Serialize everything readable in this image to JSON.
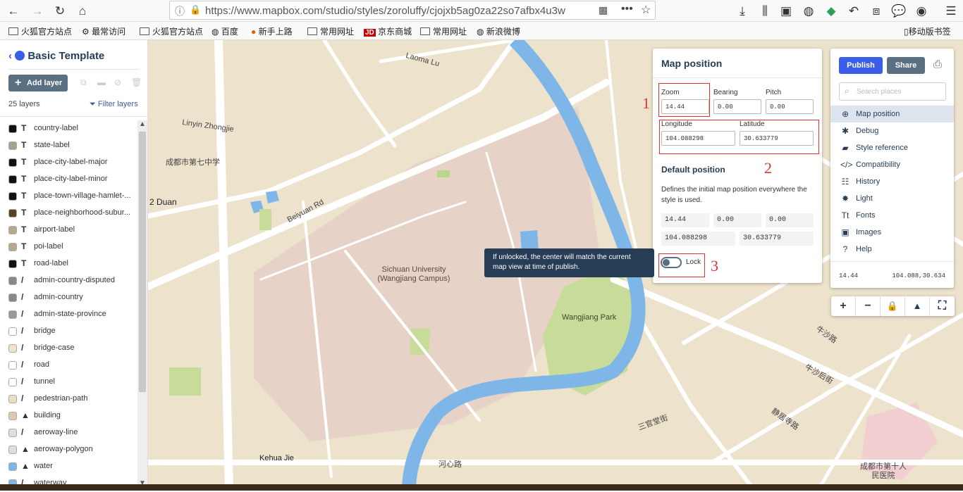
{
  "browser": {
    "url": "https://www.mapbox.com/studio/styles/zoroluffy/cjojxb5ag0za22so7afbx4u3w",
    "bookmarks": [
      "火狐官方站点",
      "最常访问",
      "火狐官方站点",
      "百度",
      "新手上路",
      "常用网址",
      "京东商城",
      "常用网址",
      "新浪微博"
    ],
    "mobile_bookmarks": "移动版书签"
  },
  "sidebar": {
    "title": "Basic Template",
    "add_layer": "Add layer",
    "layer_count": "25 layers",
    "filter": "Filter layers",
    "layers": [
      {
        "name": "country-label",
        "type": "T",
        "color": "#111111"
      },
      {
        "name": "state-label",
        "type": "T",
        "color": "#aaa08e"
      },
      {
        "name": "place-city-label-major",
        "type": "T",
        "color": "#111111"
      },
      {
        "name": "place-city-label-minor",
        "type": "T",
        "color": "#111111"
      },
      {
        "name": "place-town-village-hamlet-...",
        "type": "T",
        "color": "#111111"
      },
      {
        "name": "place-neighborhood-subur...",
        "type": "T",
        "color": "#5a4120"
      },
      {
        "name": "airport-label",
        "type": "T",
        "color": "#b8a98a"
      },
      {
        "name": "poi-label",
        "type": "T",
        "color": "#b8a98a"
      },
      {
        "name": "road-label",
        "type": "T",
        "color": "#111111"
      },
      {
        "name": "admin-country-disputed",
        "type": "/",
        "color": "#888888"
      },
      {
        "name": "admin-country",
        "type": "/",
        "color": "#888888"
      },
      {
        "name": "admin-state-province",
        "type": "/",
        "color": "#999999"
      },
      {
        "name": "bridge",
        "type": "/",
        "color": "#ffffff"
      },
      {
        "name": "bridge-case",
        "type": "/",
        "color": "#efe3c8"
      },
      {
        "name": "road",
        "type": "/",
        "color": "#ffffff"
      },
      {
        "name": "tunnel",
        "type": "/",
        "color": "#ffffff"
      },
      {
        "name": "pedestrian-path",
        "type": "/",
        "color": "#ecdcc0"
      },
      {
        "name": "building",
        "type": "▲",
        "color": "#dccbaa"
      },
      {
        "name": "aeroway-line",
        "type": "/",
        "color": "#dddddd"
      },
      {
        "name": "aeroway-polygon",
        "type": "▲",
        "color": "#dddddd"
      },
      {
        "name": "water",
        "type": "▲",
        "color": "#7fb6e8"
      },
      {
        "name": "waterway",
        "type": "/",
        "color": "#7fb6e8"
      }
    ]
  },
  "position_panel": {
    "title": "Map position",
    "zoom_label": "Zoom",
    "zoom": "14.44",
    "bearing_label": "Bearing",
    "bearing": "0.00",
    "pitch_label": "Pitch",
    "pitch": "0.00",
    "longitude_label": "Longitude",
    "longitude": "104.088298",
    "latitude_label": "Latitude",
    "latitude": "30.633779",
    "default_title": "Default position",
    "default_desc": "Defines the initial map position everywhere the style is used.",
    "default_zoom": "14.44",
    "default_bearing": "0.00",
    "default_pitch": "0.00",
    "default_longitude": "104.088298",
    "default_latitude": "30.633779",
    "lock_label": "Lock",
    "annotations": [
      "1",
      "2",
      "3"
    ]
  },
  "tooltip": "If unlocked, the center will match the current map view at time of publish.",
  "right_panel": {
    "publish": "Publish",
    "share": "Share",
    "search_placeholder": "Search places",
    "menu": [
      "Map position",
      "Debug",
      "Style reference",
      "Compatibility",
      "History",
      "Light",
      "Fonts",
      "Images",
      "Help"
    ],
    "zoom": "14.44",
    "coords": "104.088,30.634"
  },
  "map_labels": {
    "laoma_lu": "Laoma Lu",
    "linyin": "Linyin Zhongjie",
    "school": "成都市第七中学",
    "duan": "2 Duan",
    "beiyuan": "Beiyuan Rd",
    "university": "Sichuan University (Wangjiang Campus)",
    "park": "Wangjiang Park",
    "kehua": "Kehua Jie",
    "hexin": "河心路",
    "sanguan": "三官堂街",
    "jingyuan": "静居寺路",
    "hospital": "成都市第十人民医院",
    "niusha": "牛沙路",
    "niushahou": "牛沙后街"
  },
  "colors": {
    "water": "#7fb6e8",
    "park": "#c8dc9a",
    "campus": "#e8d3c8",
    "land": "#ede2cc",
    "accent": "#3b5ee8",
    "annotation": "#dd3333"
  }
}
